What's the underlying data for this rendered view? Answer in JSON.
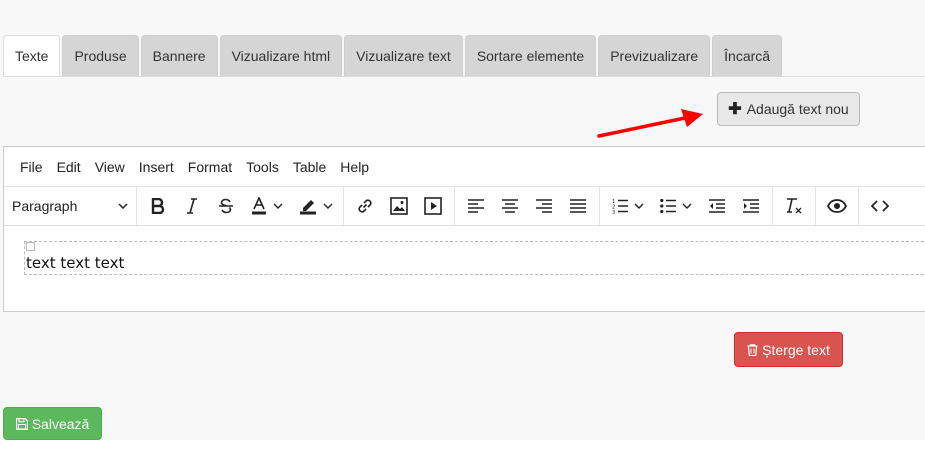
{
  "tabs": [
    {
      "label": "Texte",
      "active": true
    },
    {
      "label": "Produse",
      "active": false
    },
    {
      "label": "Bannere",
      "active": false
    },
    {
      "label": "Vizualizare html",
      "active": false
    },
    {
      "label": "Vizualizare text",
      "active": false
    },
    {
      "label": "Sortare elemente",
      "active": false
    },
    {
      "label": "Previzualizare",
      "active": false
    },
    {
      "label": "Încarcă",
      "active": false
    }
  ],
  "add_text_button": {
    "icon": "plus-icon",
    "label": "Adaugă text nou"
  },
  "annotation": {
    "icon": "red-arrow-icon",
    "color": "#ff0000"
  },
  "editor": {
    "menubar": [
      "File",
      "Edit",
      "View",
      "Insert",
      "Format",
      "Tools",
      "Table",
      "Help"
    ],
    "block_format": "Paragraph",
    "toolbar_icons": [
      "bold-icon",
      "italic-icon",
      "strikethrough-icon",
      "text-color-icon",
      "highlight-icon",
      "link-icon",
      "image-icon",
      "media-icon",
      "align-left-icon",
      "align-center-icon",
      "align-right-icon",
      "align-justify-icon",
      "numbered-list-icon",
      "bullet-list-icon",
      "outdent-icon",
      "indent-icon",
      "clear-format-icon",
      "preview-icon",
      "source-code-icon"
    ],
    "content_text": "text text text"
  },
  "delete_button": {
    "icon": "trash-icon",
    "label": "Șterge text",
    "color": "#d9534f"
  },
  "save_button": {
    "icon": "floppy-disk-icon",
    "label": "Salvează",
    "color": "#5cb85c"
  }
}
